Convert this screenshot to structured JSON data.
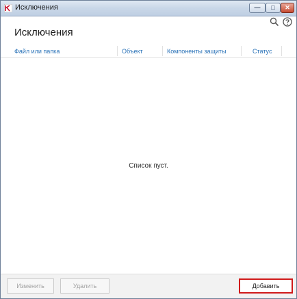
{
  "window": {
    "title": "Исключения",
    "controls": {
      "minimize": "—",
      "maximize": "□",
      "close": "✕"
    }
  },
  "toolbar": {
    "icons": [
      "search-icon",
      "help-icon"
    ]
  },
  "main": {
    "heading": "Исключения",
    "columns": [
      "Файл или папка",
      "Объект",
      "Компоненты защиты",
      "Статус"
    ],
    "empty_message": "Список пуст."
  },
  "footer": {
    "edit_label": "Изменить",
    "delete_label": "Удалить",
    "add_label": "Добавить"
  },
  "colors": {
    "accent": "#2b73b8",
    "highlight": "#d01919"
  }
}
